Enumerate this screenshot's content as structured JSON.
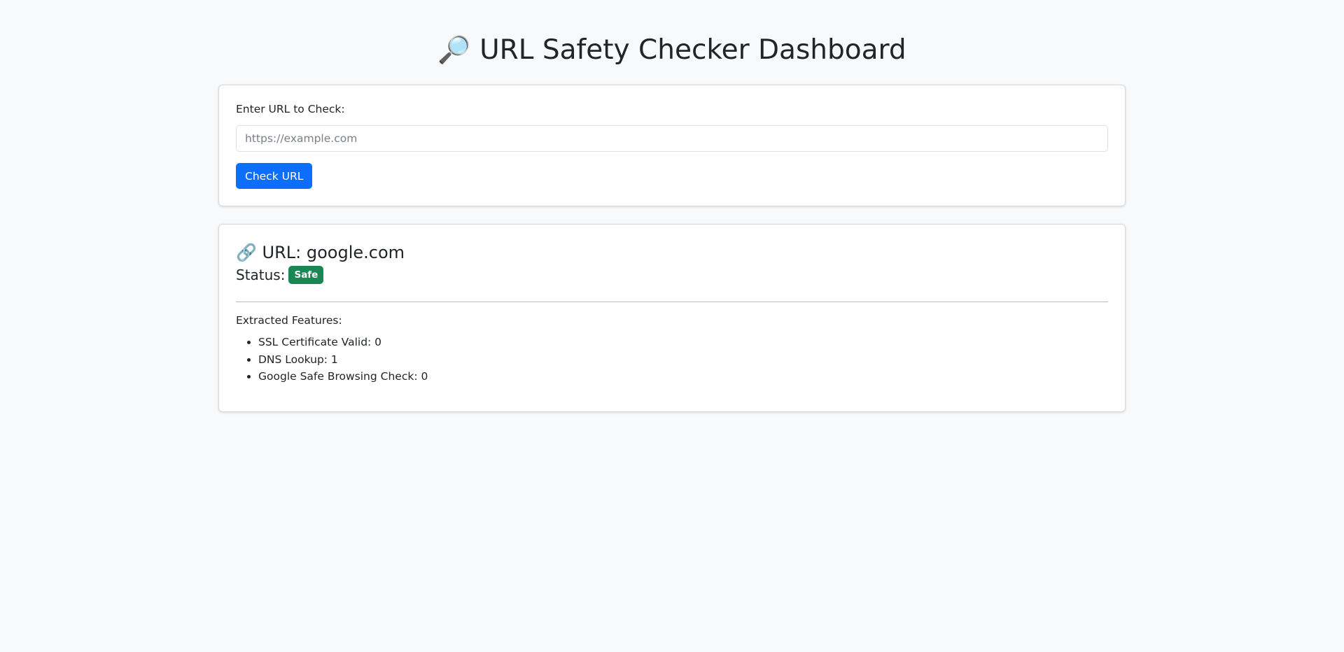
{
  "header": {
    "icon": "🔎",
    "title": "URL Safety Checker Dashboard"
  },
  "form": {
    "label": "Enter URL to Check:",
    "input_value": "",
    "input_placeholder": "https://example.com",
    "button_label": "Check URL"
  },
  "result": {
    "url_icon": "🔗",
    "url_text": "URL: google.com",
    "status_label": "Status:",
    "status_value": "Safe",
    "features_title": "Extracted Features:",
    "features": [
      "SSL Certificate Valid: 0",
      "DNS Lookup: 1",
      "Google Safe Browsing Check: 0"
    ]
  },
  "colors": {
    "primary": "#0d6efd",
    "success": "#198754",
    "background": "#f8f9fa"
  }
}
